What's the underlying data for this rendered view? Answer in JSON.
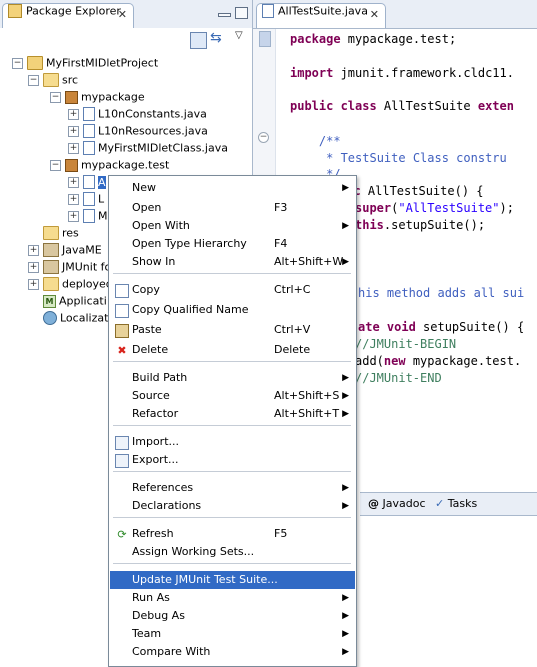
{
  "left_view": {
    "tab_title": "Package Explorer",
    "tree": [
      {
        "label": "MyFirstMIDletProject",
        "icon": "project-icon",
        "expander": "−"
      },
      {
        "label": "src",
        "icon": "source-folder-icon",
        "expander": "−"
      },
      {
        "label": "mypackage",
        "icon": "package-icon",
        "expander": "−"
      },
      {
        "label": "L10nConstants.java",
        "icon": "java-file-icon",
        "expander": "+"
      },
      {
        "label": "L10nResources.java",
        "icon": "java-file-icon",
        "expander": "+"
      },
      {
        "label": "MyFirstMIDletClass.java",
        "icon": "java-file-icon",
        "expander": "+"
      },
      {
        "label": "mypackage.test",
        "icon": "package-icon",
        "expander": "−"
      },
      {
        "label": "A",
        "icon": "java-file-icon",
        "expander": "+"
      },
      {
        "label": "L",
        "icon": "java-file-icon",
        "expander": "+"
      },
      {
        "label": "M",
        "icon": "java-file-icon",
        "expander": "+"
      },
      {
        "label": "res",
        "icon": "folder-icon",
        "expander": ""
      },
      {
        "label": "JavaME",
        "icon": "library-icon",
        "expander": "+"
      },
      {
        "label": "JMUnit fo",
        "icon": "library-icon",
        "expander": "+"
      },
      {
        "label": "deployed",
        "icon": "folder-icon",
        "expander": "+"
      },
      {
        "label": "Applicati",
        "icon": "manifest-icon",
        "expander": ""
      },
      {
        "label": "Localizati",
        "icon": "globe-icon",
        "expander": ""
      }
    ]
  },
  "editor": {
    "tab_title": "AllTestSuite.java",
    "lines": [
      {
        "segments": [
          {
            "t": "package",
            "c": "kw"
          },
          {
            "t": " mypackage.test;",
            "c": ""
          }
        ]
      },
      {
        "segments": [
          {
            "t": "import",
            "c": "kw"
          },
          {
            "t": " jmunit.framework.cldc11.",
            "c": ""
          }
        ]
      },
      {
        "segments": [
          {
            "t": "public class",
            "c": "kw"
          },
          {
            "t": " AllTestSuite ",
            "c": ""
          },
          {
            "t": "exten",
            "c": "kw"
          }
        ]
      },
      {
        "segments": [
          {
            "t": "    /**",
            "c": "jd"
          }
        ]
      },
      {
        "segments": [
          {
            "t": "     * TestSuite Class constru",
            "c": "jd"
          }
        ]
      },
      {
        "segments": [
          {
            "t": "     */",
            "c": "jd"
          }
        ]
      },
      {
        "segments": [
          {
            "t": "lic",
            "c": "kw"
          },
          {
            "t": " AllTestSuite() {",
            "c": ""
          }
        ]
      },
      {
        "segments": [
          {
            "t": "super",
            "c": "kw"
          },
          {
            "t": "(",
            "c": ""
          },
          {
            "t": "\"AllTestSuite\"",
            "c": "str"
          },
          {
            "t": ");",
            "c": ""
          }
        ]
      },
      {
        "segments": [
          {
            "t": "this",
            "c": "kw"
          },
          {
            "t": ".setupSuite();",
            "c": ""
          }
        ]
      },
      {
        "segments": [
          {
            "t": "his method adds all sui",
            "c": "jd"
          }
        ]
      },
      {
        "segments": [
          {
            "t": "ate void",
            "c": "kw"
          },
          {
            "t": " setupSuite() {",
            "c": ""
          }
        ]
      },
      {
        "segments": [
          {
            "t": "//JMUnit-BEGIN",
            "c": "cm"
          }
        ]
      },
      {
        "segments": [
          {
            "t": "add(",
            "c": ""
          },
          {
            "t": "new",
            "c": "kw"
          },
          {
            "t": " mypackage.test.",
            "c": ""
          }
        ]
      },
      {
        "segments": [
          {
            "t": "//JMUnit-END",
            "c": "cm"
          }
        ]
      }
    ]
  },
  "bottom_tabs": [
    {
      "label": "Javadoc",
      "icon": "at-icon"
    },
    {
      "label": "Tasks",
      "icon": "tasks-icon"
    }
  ],
  "context_menu": {
    "items": [
      {
        "label": "New",
        "shortcut": "",
        "submenu": true,
        "icon": ""
      },
      {
        "label": "Open",
        "shortcut": "F3",
        "submenu": false,
        "icon": ""
      },
      {
        "label": "Open With",
        "shortcut": "",
        "submenu": true,
        "icon": ""
      },
      {
        "label": "Open Type Hierarchy",
        "shortcut": "F4",
        "submenu": false,
        "icon": ""
      },
      {
        "label": "Show In",
        "shortcut": "Alt+Shift+W",
        "submenu": true,
        "icon": ""
      },
      {
        "label": "Copy",
        "shortcut": "Ctrl+C",
        "submenu": false,
        "icon": "copy-icon"
      },
      {
        "label": "Copy Qualified Name",
        "shortcut": "",
        "submenu": false,
        "icon": "copy-qualified-icon"
      },
      {
        "label": "Paste",
        "shortcut": "Ctrl+V",
        "submenu": false,
        "icon": "paste-icon"
      },
      {
        "label": "Delete",
        "shortcut": "Delete",
        "submenu": false,
        "icon": "delete-icon"
      },
      {
        "label": "Build Path",
        "shortcut": "",
        "submenu": true,
        "icon": ""
      },
      {
        "label": "Source",
        "shortcut": "Alt+Shift+S",
        "submenu": true,
        "icon": ""
      },
      {
        "label": "Refactor",
        "shortcut": "Alt+Shift+T",
        "submenu": true,
        "icon": ""
      },
      {
        "label": "Import...",
        "shortcut": "",
        "submenu": false,
        "icon": "import-icon"
      },
      {
        "label": "Export...",
        "shortcut": "",
        "submenu": false,
        "icon": "export-icon"
      },
      {
        "label": "References",
        "shortcut": "",
        "submenu": true,
        "icon": ""
      },
      {
        "label": "Declarations",
        "shortcut": "",
        "submenu": true,
        "icon": ""
      },
      {
        "label": "Refresh",
        "shortcut": "F5",
        "submenu": false,
        "icon": "refresh-icon"
      },
      {
        "label": "Assign Working Sets...",
        "shortcut": "",
        "submenu": false,
        "icon": ""
      },
      {
        "label": "Update JMUnit Test Suite...",
        "shortcut": "",
        "submenu": false,
        "icon": "",
        "highlighted": true
      },
      {
        "label": "Run As",
        "shortcut": "",
        "submenu": true,
        "icon": ""
      },
      {
        "label": "Debug As",
        "shortcut": "",
        "submenu": true,
        "icon": ""
      },
      {
        "label": "Team",
        "shortcut": "",
        "submenu": true,
        "icon": ""
      },
      {
        "label": "Compare With",
        "shortcut": "",
        "submenu": true,
        "icon": ""
      }
    ]
  },
  "colors": {
    "selection": "#316ac5",
    "keyword": "#7f0055",
    "comment": "#3f7f5f",
    "javadoc": "#3f5fbf",
    "string": "#2a00ff"
  }
}
